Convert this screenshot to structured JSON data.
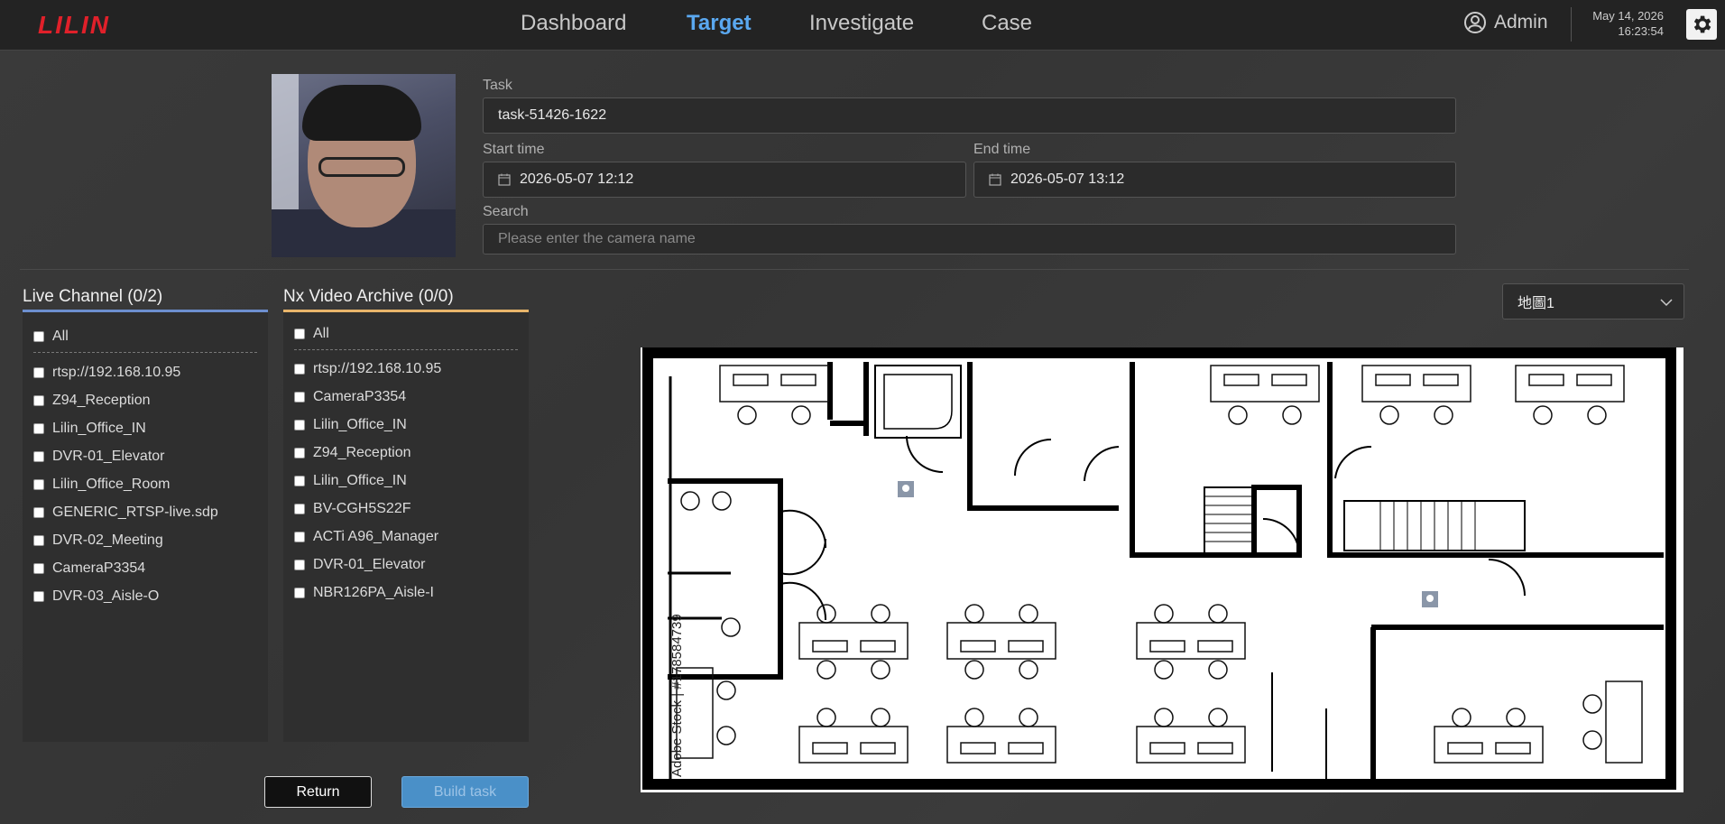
{
  "header": {
    "logo": "LILIN",
    "nav": [
      {
        "label": "Dashboard",
        "active": false
      },
      {
        "label": "Target",
        "active": true
      },
      {
        "label": "Investigate",
        "active": false
      },
      {
        "label": "Case",
        "active": false
      }
    ],
    "user": "Admin",
    "date": "May 14, 2026",
    "time": "16:23:54",
    "icons": {
      "user": "user-circle-icon",
      "settings": "gear-icon"
    }
  },
  "form": {
    "task_label": "Task",
    "task_value": "task-51426-1622",
    "start_label": "Start time",
    "start_value": "2026-05-07 12:12",
    "end_label": "End time",
    "end_value": "2026-05-07 13:12",
    "search_label": "Search",
    "search_placeholder": "Please enter the camera name"
  },
  "live_channel": {
    "title": "Live Channel (0/2)",
    "all_label": "All",
    "items": [
      "rtsp://192.168.10.95",
      "Z94_Reception",
      "Lilin_Office_IN",
      "DVR-01_Elevator",
      "Lilin_Office_Room",
      "GENERIC_RTSP-live.sdp",
      "DVR-02_Meeting",
      "CameraP3354",
      "DVR-03_Aisle-O"
    ]
  },
  "nx_archive": {
    "title": "Nx Video Archive (0/0)",
    "all_label": "All",
    "items": [
      "rtsp://192.168.10.95",
      "CameraP3354",
      "Lilin_Office_IN",
      "Z94_Reception",
      "Lilin_Office_IN",
      "BV-CGH5S22F",
      "ACTi A96_Manager",
      "DVR-01_Elevator",
      "NBR126PA_Aisle-I"
    ]
  },
  "buttons": {
    "return": "Return",
    "build": "Build task"
  },
  "map": {
    "selected": "地圖1",
    "watermark": "Adobe Stock | #178584739"
  },
  "colors": {
    "accent": "#5aa8f0",
    "live_border": "#6d8fcf",
    "nx_border": "#e8b56a",
    "logo": "#e0202a"
  }
}
